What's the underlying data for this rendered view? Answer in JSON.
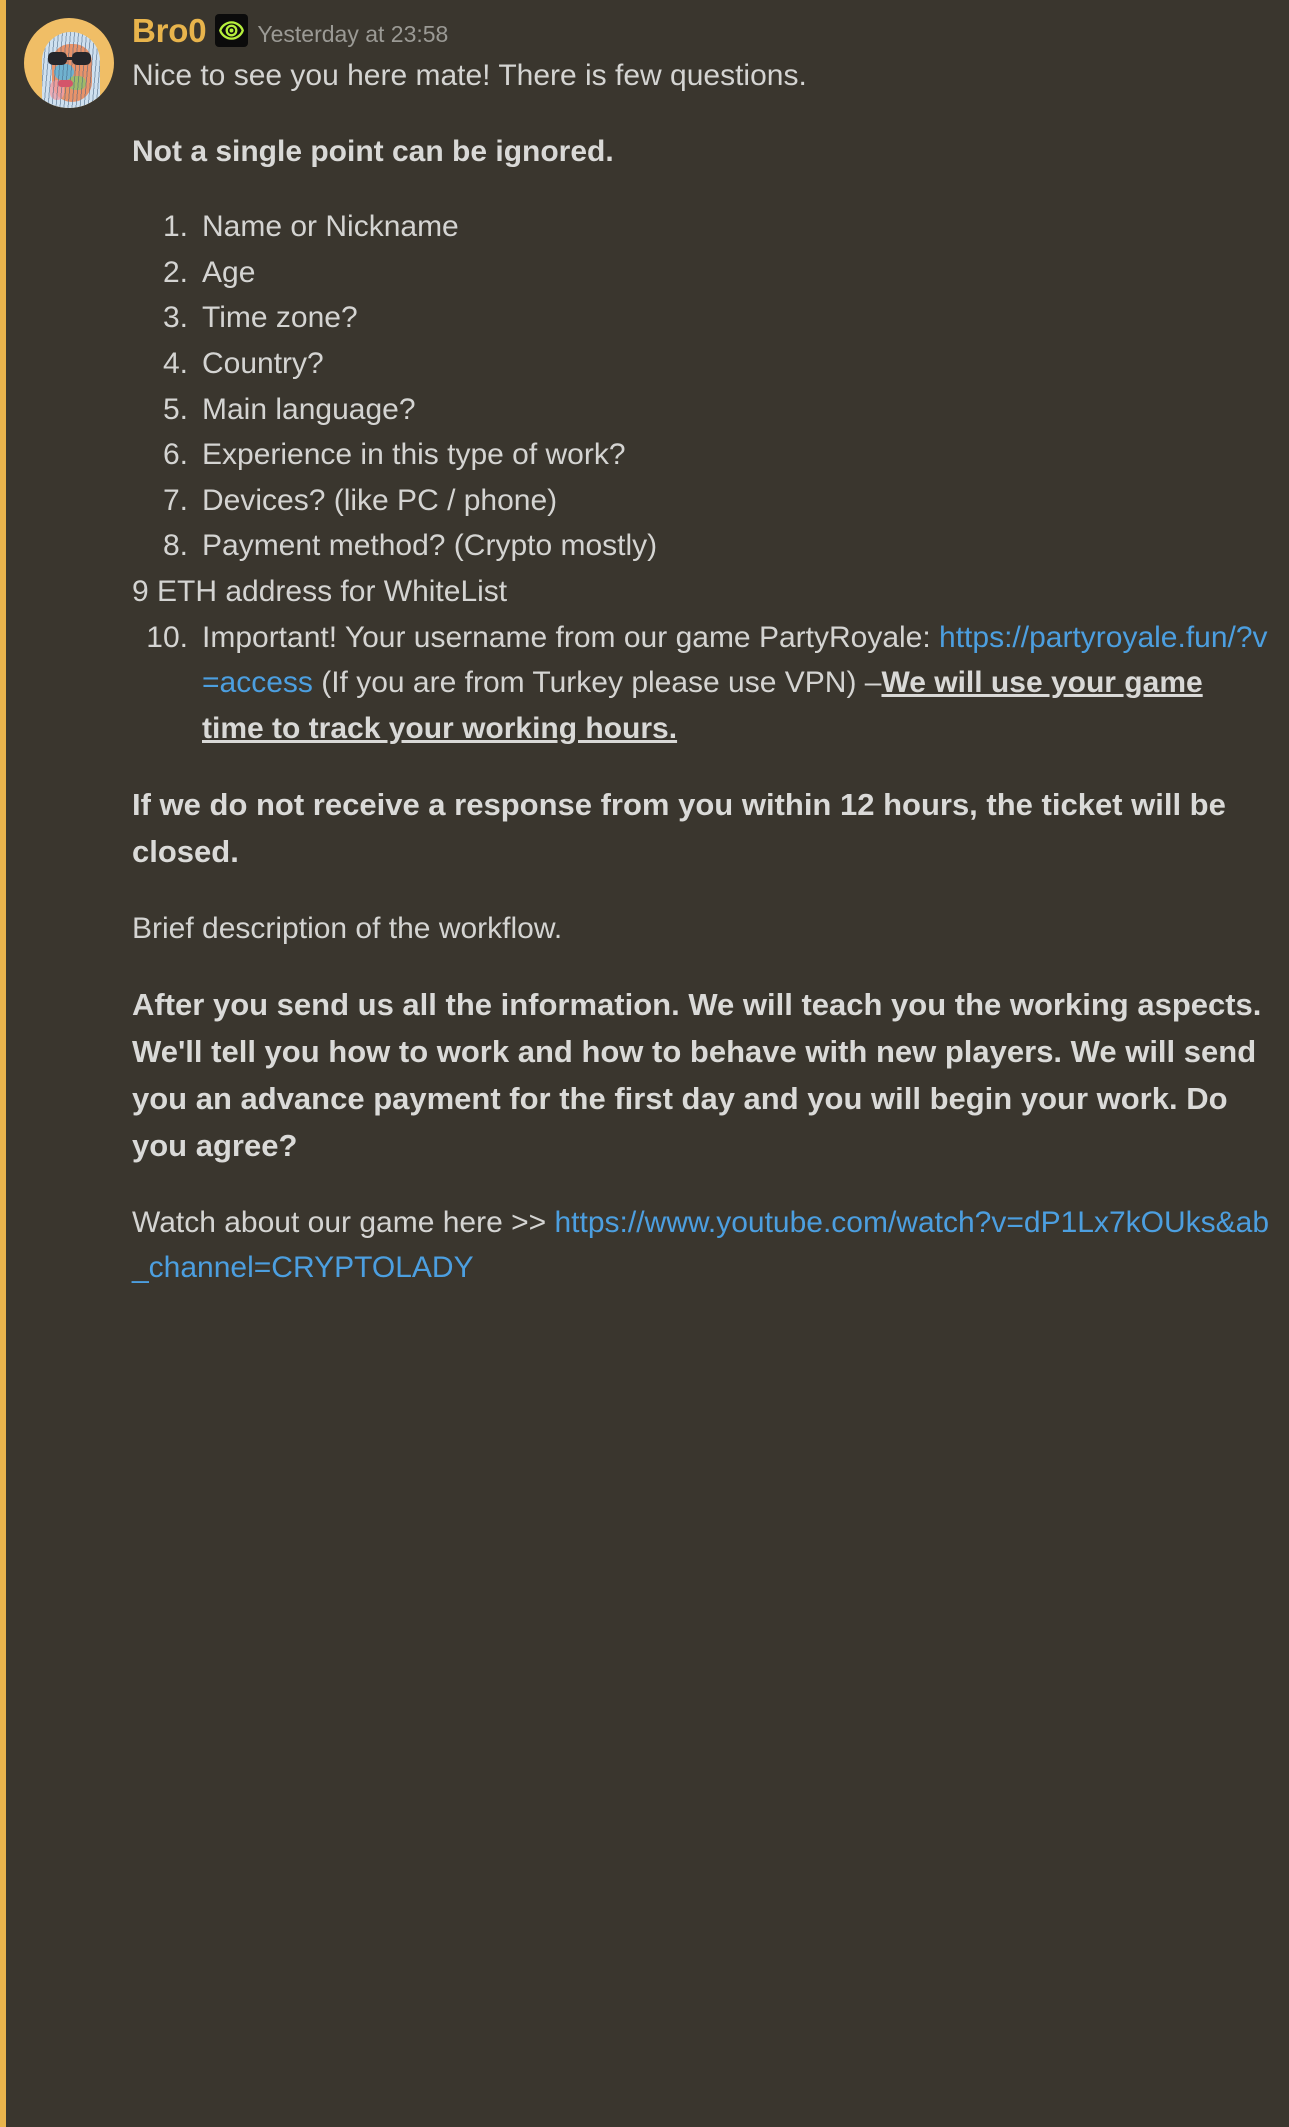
{
  "message": {
    "author": "Bro0",
    "badge_icon": "target-eye-icon",
    "timestamp": "Yesterday at 23:58",
    "greeting": "Nice to see you here mate! There is few questions.",
    "emphasis_heading": "Not a single point can be ignored.",
    "questions": [
      {
        "n": "1",
        "text": "Name or Nickname",
        "numbered": true
      },
      {
        "n": "2",
        "text": "Age",
        "numbered": true
      },
      {
        "n": "3",
        "text": "Time zone?",
        "numbered": true
      },
      {
        "n": "4",
        "text": "Country?",
        "numbered": true
      },
      {
        "n": "5",
        "text": "Main language?",
        "numbered": true
      },
      {
        "n": "6",
        "text": "Experience in this type of work?",
        "numbered": true
      },
      {
        "n": "7",
        "text": "Devices? (like PC / phone)",
        "numbered": true
      },
      {
        "n": "8",
        "text": "Payment method? (Crypto mostly)",
        "numbered": true
      },
      {
        "n": "9",
        "text": "9 ETH address for WhiteList",
        "numbered": false
      }
    ],
    "item10": {
      "lead": "Important! Your username from our game PartyRoyale: ",
      "link_text": "https://partyroyale.fun/?v=access",
      "link_href": "https://partyroyale.fun/?v=access",
      "vpn_note": " (If you are from Turkey please use VPN) –",
      "underlined_bold": "We will use your game time to track your working hours."
    },
    "warning": "If we do not receive a response from you within 12 hours, the ticket will be closed.",
    "workflow_intro": "Brief description of the workflow.",
    "workflow_body": "After you send us all the information. We will teach you the working aspects. We'll tell you how to work and how to behave with new players. We will send you an advance payment for the first day and you will begin your work. Do you agree?",
    "watch_lead": "Watch about our game here >> ",
    "youtube_link_text": "https://www.youtube.com/watch?v=dP1Lx7kOUks&ab_channel=CRYPTOLADY",
    "youtube_link_href": "https://www.youtube.com/watch?v=dP1Lx7kOUks&ab_channel=CRYPTOLADY"
  },
  "colors": {
    "background": "#3a362e",
    "mention_bar": "#e8b44c",
    "username": "#e8b44c",
    "link": "#4c9fe0",
    "text": "#d4d4d2",
    "timestamp": "#9b9a95",
    "badge_green": "#b6f03c"
  }
}
